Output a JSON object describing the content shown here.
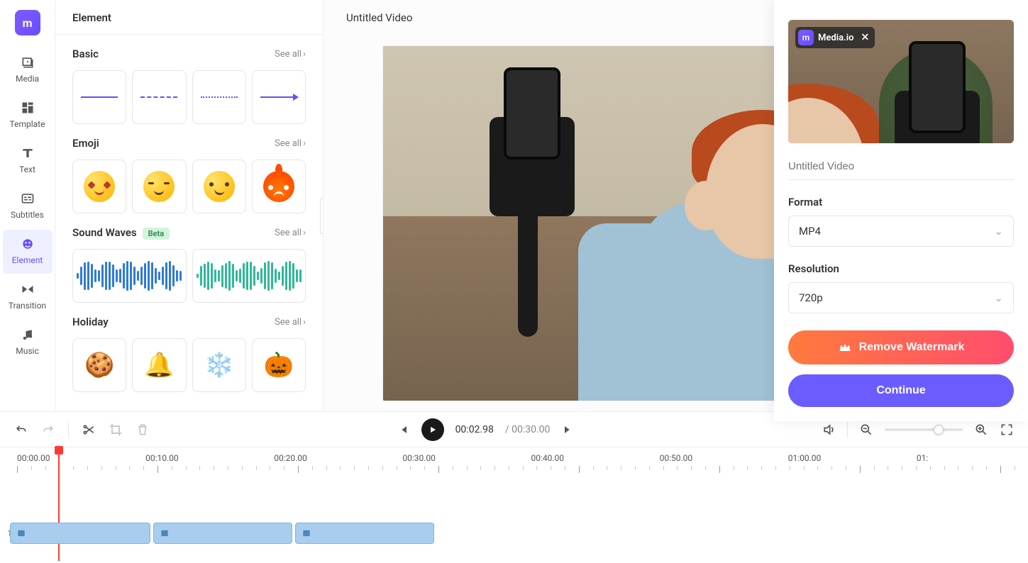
{
  "brand": "Media.io",
  "sidebar": {
    "items": [
      {
        "label": "Media"
      },
      {
        "label": "Template"
      },
      {
        "label": "Text"
      },
      {
        "label": "Subtitles"
      },
      {
        "label": "Element"
      },
      {
        "label": "Transition"
      },
      {
        "label": "Music"
      }
    ]
  },
  "panel": {
    "title": "Element",
    "see_all": "See all",
    "sections": {
      "basic": {
        "title": "Basic"
      },
      "emoji": {
        "title": "Emoji"
      },
      "sound": {
        "title": "Sound Waves",
        "badge": "Beta"
      },
      "holiday": {
        "title": "Holiday"
      }
    }
  },
  "preview": {
    "title": "Untitled Video"
  },
  "export": {
    "title_placeholder": "Untitled Video",
    "format_label": "Format",
    "format_value": "MP4",
    "resolution_label": "Resolution",
    "resolution_value": "720p",
    "remove_watermark": "Remove Watermark",
    "continue": "Continue"
  },
  "playback": {
    "current": "00:02.98",
    "sep": "/",
    "duration": "00:30.00"
  },
  "timeline": {
    "labels": [
      "00:00.00",
      "00:10.00",
      "00:20.00",
      "00:30.00",
      "00:40.00",
      "00:50.00",
      "01:00.00",
      "01:"
    ],
    "track_index": "1"
  }
}
